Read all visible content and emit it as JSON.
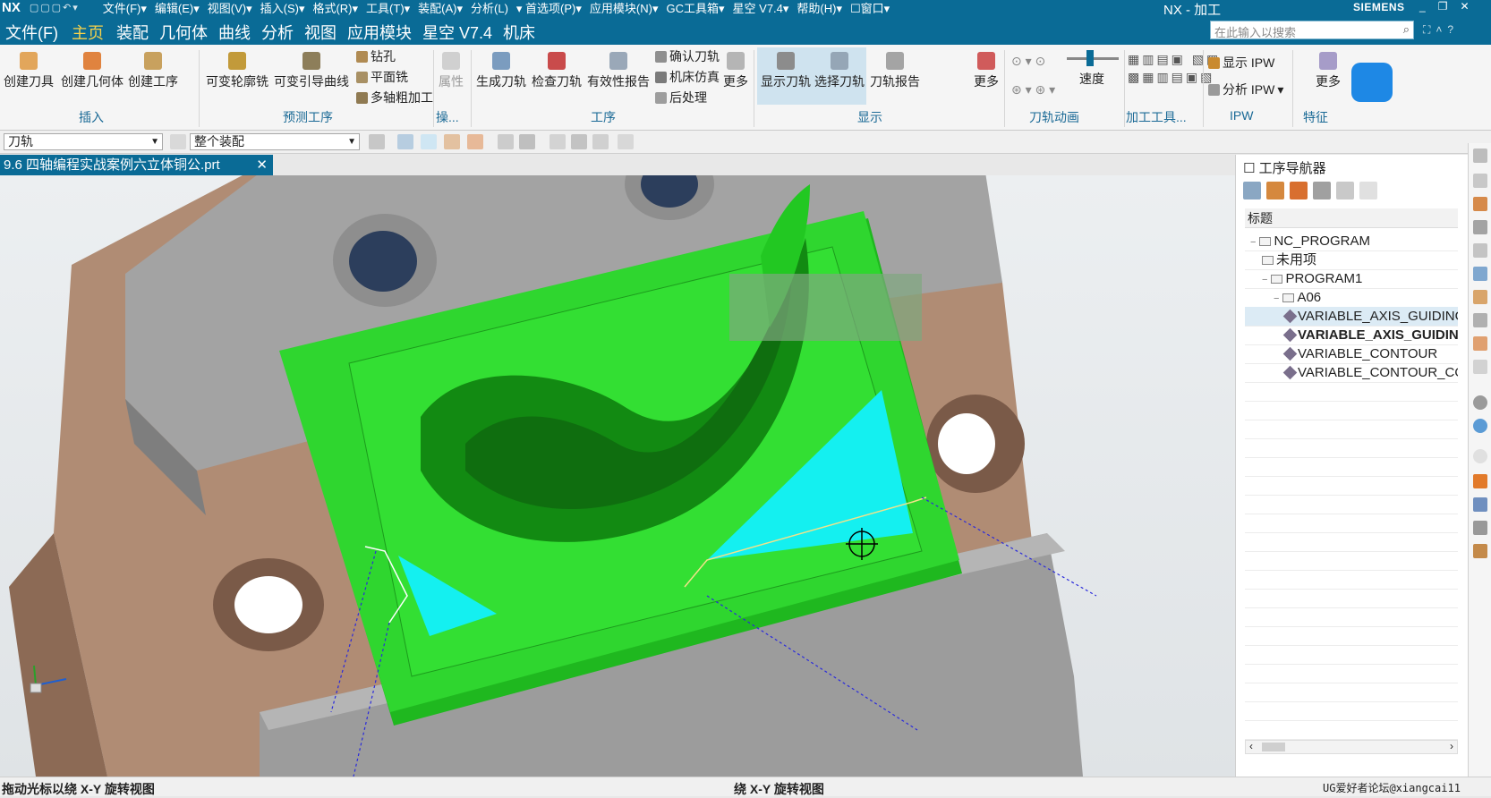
{
  "titlebar": {
    "logo": "NX",
    "menus": [
      "文件(F)▾",
      "编辑(E)▾",
      "视图(V)▾",
      "插入(S)▾",
      "格式(R)▾",
      "工具(T)▾",
      "装配(A)▾",
      "分析(L)",
      "▾ 首选项(P)▾",
      "应用模块(N)▾",
      "GC工具箱▾",
      "星空 V7.4▾",
      "帮助(H)▾",
      "☐窗口▾"
    ],
    "app_title": "NX - 加工",
    "brand": "SIEMENS"
  },
  "tabs": [
    {
      "label": "文件(F)",
      "active": false
    },
    {
      "label": "主页",
      "active": true
    },
    {
      "label": "装配",
      "active": false
    },
    {
      "label": "几何体",
      "active": false
    },
    {
      "label": "曲线",
      "active": false
    },
    {
      "label": "分析",
      "active": false
    },
    {
      "label": "视图",
      "active": false
    },
    {
      "label": "应用模块",
      "active": false
    },
    {
      "label": "星空 V7.4",
      "active": false
    },
    {
      "label": "机床",
      "active": false
    }
  ],
  "search": {
    "placeholder": "在此输入以搜索"
  },
  "ribbon": {
    "insert": {
      "group": "插入",
      "create_tool": "创建刀具",
      "create_geometry": "创建几何体",
      "create_operation": "创建工序"
    },
    "predict": {
      "group": "预测工序",
      "var_contour": "可变轮廓铣",
      "var_guide": "可变引导曲线",
      "drill": "钻孔",
      "face_mill": "平面铣",
      "multi_axis_rough": "多轴粗加工"
    },
    "attr": {
      "group": "操...",
      "label": "属性"
    },
    "operation": {
      "group": "工序",
      "gen_path": "生成刀轨",
      "check_path": "检查刀轨",
      "validity": "有效性报告",
      "confirm": "确认刀轨",
      "sim": "机床仿真",
      "post": "后处理",
      "more": "更多"
    },
    "display": {
      "group": "显示",
      "show_path": "显示刀轨",
      "select_path": "选择刀轨",
      "report": "刀轨报告",
      "more": "更多"
    },
    "animation": {
      "group": "刀轨动画",
      "speed": "速度"
    },
    "machining_tools": {
      "group": "加工工具..."
    },
    "ipw": {
      "group": "IPW",
      "show_ipw": "显示 IPW",
      "analyze_ipw": "分析 IPW"
    },
    "feature": {
      "group": "特征",
      "more": "更多"
    }
  },
  "selection_bar": {
    "filter": "刀轨",
    "scope": "整个装配"
  },
  "file_tab": {
    "name": "9.6 四轴编程实战案例六立体铜公.prt"
  },
  "navigator": {
    "title": "工序导航器",
    "column": "标题",
    "rows": [
      {
        "label": "NC_PROGRAM",
        "kind": "folder",
        "level": 0,
        "exp": "−"
      },
      {
        "label": "未用项",
        "kind": "folder",
        "level": 1,
        "exp": ""
      },
      {
        "label": "PROGRAM1",
        "kind": "folder",
        "level": 1,
        "exp": "−"
      },
      {
        "label": "A06",
        "kind": "folder",
        "level": 2,
        "exp": "−"
      },
      {
        "label": "VARIABLE_AXIS_GUIDING_CURVES",
        "kind": "op",
        "level": 3,
        "exp": "",
        "selected": true
      },
      {
        "label": "VARIABLE_AXIS_GUIDING_CURVES_COPY",
        "kind": "op",
        "level": 3,
        "exp": "",
        "bold": true
      },
      {
        "label": "VARIABLE_CONTOUR",
        "kind": "op",
        "level": 3,
        "exp": ""
      },
      {
        "label": "VARIABLE_CONTOUR_COPY",
        "kind": "op",
        "level": 3,
        "exp": ""
      }
    ]
  },
  "status": {
    "left": "拖动光标以绕 X-Y 旋转视图",
    "middle": "绕 X-Y 旋转视图",
    "watermark": "UG爱好者论坛@xiangcai11"
  },
  "colors": {
    "accent": "#0a6b96",
    "active_tab": "#f7d24a",
    "part_green": "#2fd62f",
    "cut_cyan": "#14f0f0",
    "fixture_gray": "#9c9c9c",
    "base_brown": "#b08c74"
  }
}
